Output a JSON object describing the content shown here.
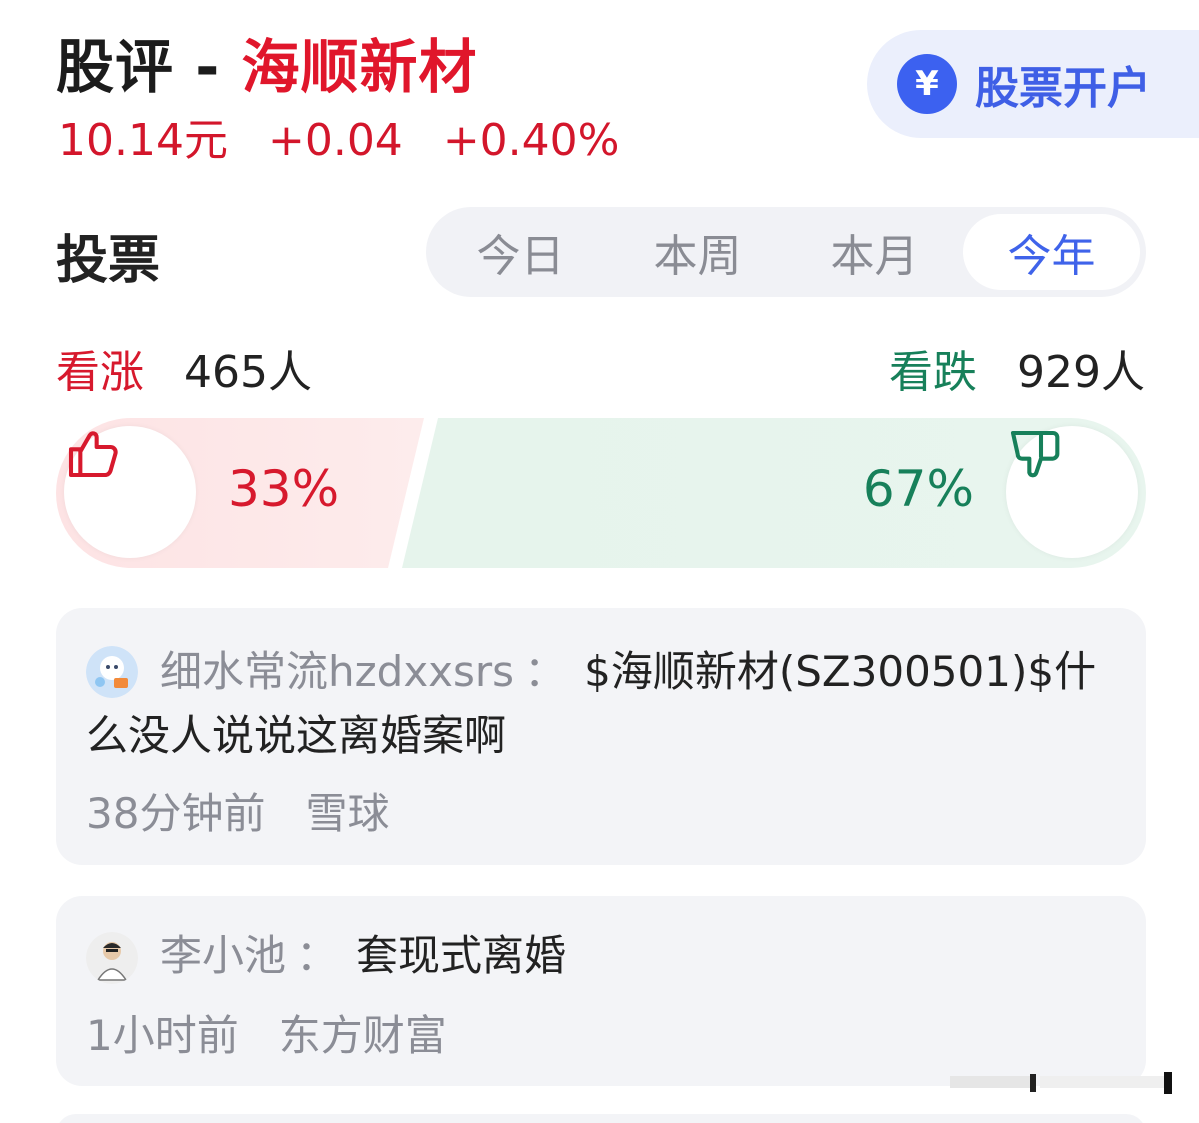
{
  "header": {
    "title_prefix": "股评 - ",
    "stock_name": "海顺新材",
    "price": "10.14元",
    "change": "+0.04",
    "change_pct": "+0.40%"
  },
  "open_account": {
    "icon": "yen-icon",
    "icon_glyph": "¥",
    "label": "股票开户"
  },
  "vote": {
    "title": "投票",
    "tabs": [
      {
        "label": "今日",
        "active": false
      },
      {
        "label": "本周",
        "active": false
      },
      {
        "label": "本月",
        "active": false
      },
      {
        "label": "今年",
        "active": true
      }
    ],
    "bullish_label": "看涨",
    "bullish_count": "465人",
    "bearish_label": "看跌",
    "bearish_count": "929人",
    "bullish_pct": "33%",
    "bearish_pct": "67%",
    "bullish_fraction": 0.33
  },
  "posts": [
    {
      "user": "细水常流hzdxxsrs",
      "separator": "：",
      "content": "$海顺新材(SZ300501)$什么没人说说这离婚案啊",
      "time": "38分钟前",
      "source": "雪球"
    },
    {
      "user": "李小池",
      "separator": "：",
      "content": "套现式离婚",
      "time": "1小时前",
      "source": "东方财富"
    }
  ],
  "colors": {
    "red": "#d7192d",
    "green": "#17805a",
    "blue": "#3f63ea"
  }
}
